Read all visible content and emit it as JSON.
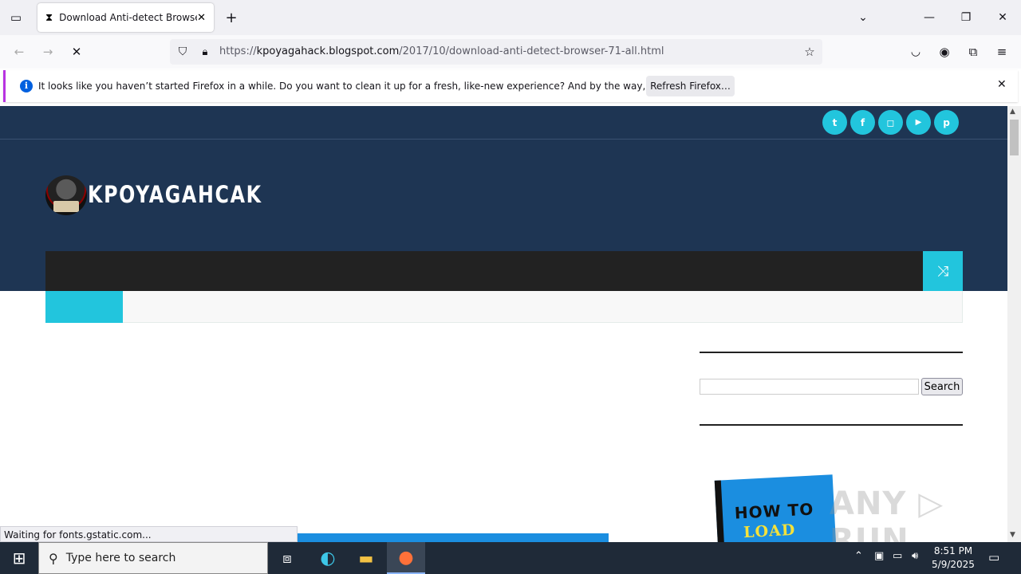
{
  "browser": {
    "tab_title": "Download Anti-detect Browser",
    "url_prefix": "https://",
    "url_host": "kpoyagahack.blogspot.com",
    "url_path": "/2017/10/download-anti-detect-browser-71-all.html"
  },
  "notification": {
    "message": "It looks like you haven’t started Firefox in a while. Do you want to clean it up for a fresh, like-new experience? And by the way, welcome back!",
    "button_label": "Refresh Firefox…"
  },
  "site": {
    "logo_text": "KPOYAGAHCAK",
    "social": [
      {
        "icon": "twitter-icon",
        "glyph": "t"
      },
      {
        "icon": "facebook-icon",
        "glyph": "f"
      },
      {
        "icon": "instagram-icon",
        "glyph": "◻"
      },
      {
        "icon": "youtube-icon",
        "glyph": "▶"
      },
      {
        "icon": "pinterest-icon",
        "glyph": "p"
      }
    ],
    "search_button": "Search",
    "book_line1": "HOW TO",
    "book_line2": "LOAD",
    "accent_color": "#22c5dd",
    "header_color": "#1e3553"
  },
  "status_text": "Waiting for fonts.gstatic.com...",
  "watermark": "ANY ▷ RUN",
  "taskbar": {
    "search_placeholder": "Type here to search",
    "time": "8:51 PM",
    "date": "5/9/2025"
  }
}
